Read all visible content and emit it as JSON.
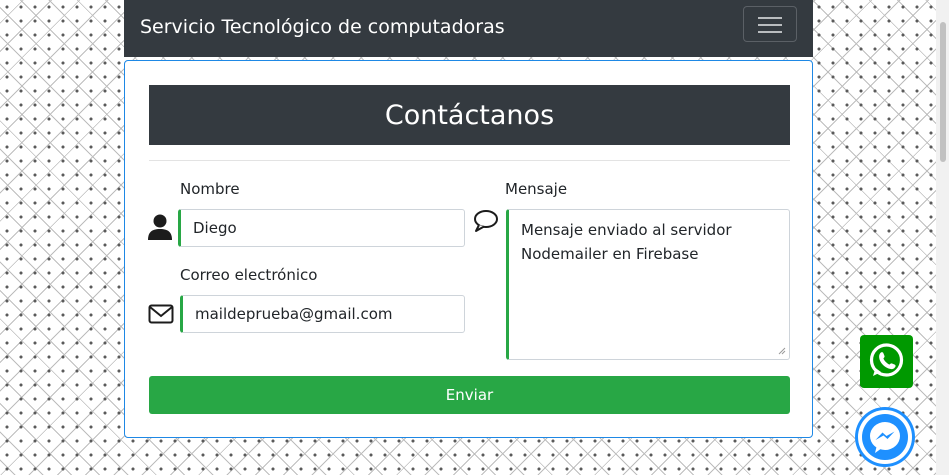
{
  "navbar": {
    "brand": "Servicio Tecnológico de computadoras",
    "toggler_icon": "hamburger-icon"
  },
  "form": {
    "title": "Contáctanos",
    "name_label": "Nombre",
    "name_value": "Diego",
    "email_label": "Correo electrónico",
    "email_value": "maildeprueba@gmail.com",
    "message_label": "Mensaje",
    "message_value": "Mensaje enviado al servidor Nodemailer en Firebase",
    "submit_label": "Enviar",
    "icons": {
      "name": "user-icon",
      "email": "envelope-icon",
      "message": "speech-bubble-icon"
    }
  },
  "floating": {
    "whatsapp_icon": "whatsapp-icon",
    "messenger_icon": "messenger-icon"
  },
  "colors": {
    "navbar": "#343a40",
    "accent": "#28a745",
    "card_border": "#1e88e5",
    "whatsapp": "#009900",
    "messenger": "#1e90ff"
  }
}
